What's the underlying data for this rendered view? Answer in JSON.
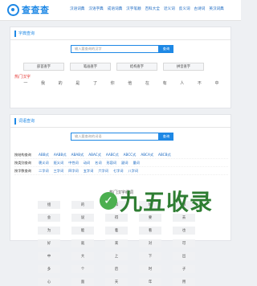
{
  "brand": {
    "name": "查查查"
  },
  "nav": [
    "汉语词典",
    "汉语字典",
    "成语词典",
    "汉字笔顺",
    "百科大全",
    "近义词",
    "反义词",
    "古诗词",
    "英汉词典",
    "英英字词"
  ],
  "zi_panel": {
    "title": "字典查询",
    "search_placeholder": "输入要查询的汉字",
    "search_button": "查询",
    "categories": [
      "部首查字",
      "笔画查字",
      "结构查字",
      "拼音查字"
    ],
    "hot_label": "热门汉字",
    "hot_chars": [
      "一",
      "我",
      "的",
      "是",
      "了",
      "你",
      "他",
      "在",
      "有",
      "人",
      "不",
      "中"
    ]
  },
  "ci_panel": {
    "title": "词语查询",
    "search_placeholder": "输入要查询的词语",
    "search_button": "查询",
    "rows": [
      {
        "label": "按结构查询",
        "values": [
          "ABB式",
          "AABB式",
          "ABAB式",
          "ABAC式",
          "AABC式",
          "ABCC式",
          "ABCA式",
          "ABCB式"
        ]
      },
      {
        "label": "按类别查询",
        "values": [
          "褒义词",
          "贬义词",
          "中性词",
          "动词",
          "名词",
          "形容词",
          "副词",
          "量词"
        ]
      },
      {
        "label": "按字数查询",
        "values": [
          "二字词",
          "三字词",
          "四字词",
          "五字词",
          "六字词",
          "七字词",
          "八字词"
        ]
      }
    ],
    "hot_title": "热门汉字组词",
    "grid": [
      "组",
      "的",
      "和",
      "地",
      "都",
      "会",
      "说",
      "得",
      "要",
      "去",
      "为",
      "能",
      "着",
      "看",
      "也",
      "好",
      "就",
      "来",
      "对",
      "可",
      "中",
      "大",
      "上",
      "下",
      "出",
      "多",
      "个",
      "后",
      "时",
      "子",
      "心",
      "面",
      "天",
      "年",
      "用"
    ]
  },
  "watermark": {
    "text": "九五收录"
  }
}
